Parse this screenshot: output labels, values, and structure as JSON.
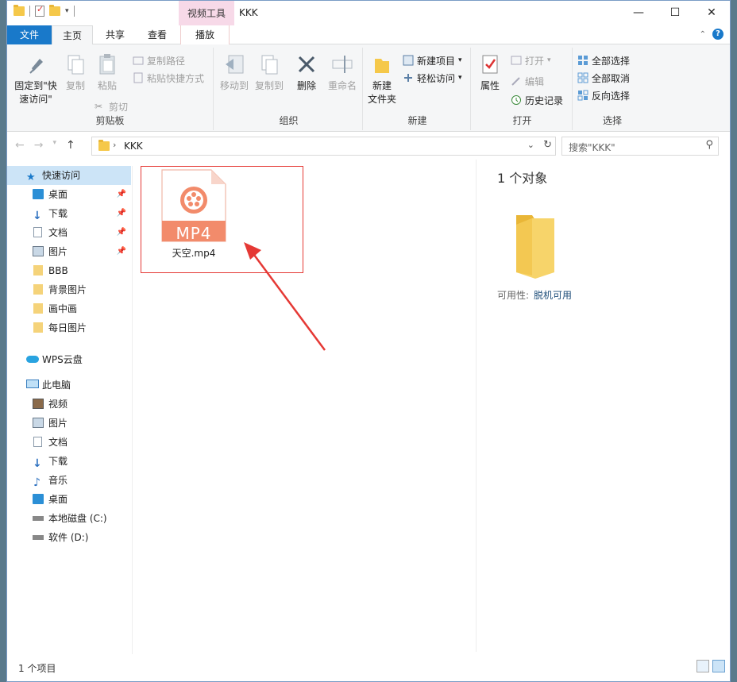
{
  "titlebar": {
    "context_tab_title": "视频工具",
    "title": "KKK",
    "minimize": "—",
    "maximize": "☐",
    "close": "✕"
  },
  "tabs": {
    "file": "文件",
    "home": "主页",
    "share": "共享",
    "view": "查看",
    "play": "播放"
  },
  "ribbon": {
    "clipboard": {
      "label": "剪贴板",
      "pin": "固定到\"快\n速访问\"",
      "copy": "复制",
      "paste": "粘贴",
      "copy_path": "复制路径",
      "paste_shortcut": "粘贴快捷方式",
      "cut": "剪切"
    },
    "organize": {
      "label": "组织",
      "move_to": "移动到",
      "copy_to": "复制到",
      "delete": "删除",
      "rename": "重命名"
    },
    "new": {
      "label": "新建",
      "new_folder": "新建\n文件夹",
      "new_item": "新建项目",
      "easy_access": "轻松访问"
    },
    "open": {
      "label": "打开",
      "properties": "属性",
      "open": "打开",
      "edit": "编辑",
      "history": "历史记录"
    },
    "select": {
      "label": "选择",
      "select_all": "全部选择",
      "select_none": "全部取消",
      "invert": "反向选择"
    }
  },
  "address": {
    "path": "KKK",
    "search_placeholder": "搜索\"KKK\""
  },
  "navpane": {
    "quick_access": "快速访问",
    "items_quick": [
      "桌面",
      "下载",
      "文档",
      "图片",
      "BBB",
      "背景图片",
      "画中画",
      "每日图片"
    ],
    "wps": "WPS云盘",
    "this_pc": "此电脑",
    "items_pc": [
      "视频",
      "图片",
      "文档",
      "下载",
      "音乐",
      "桌面",
      "本地磁盘 (C:)",
      "软件 (D:)"
    ]
  },
  "content": {
    "file_name": "天空.mp4",
    "file_badge": "MP4"
  },
  "details": {
    "count": "1 个对象",
    "availability_label": "可用性:",
    "availability_value": "脱机可用"
  },
  "status": {
    "items": "1 个项目"
  },
  "colors": {
    "accent": "#1979ca",
    "selection": "#cce4f7",
    "highlight": "#e53935",
    "mp4_badge": "#f28b6b"
  }
}
